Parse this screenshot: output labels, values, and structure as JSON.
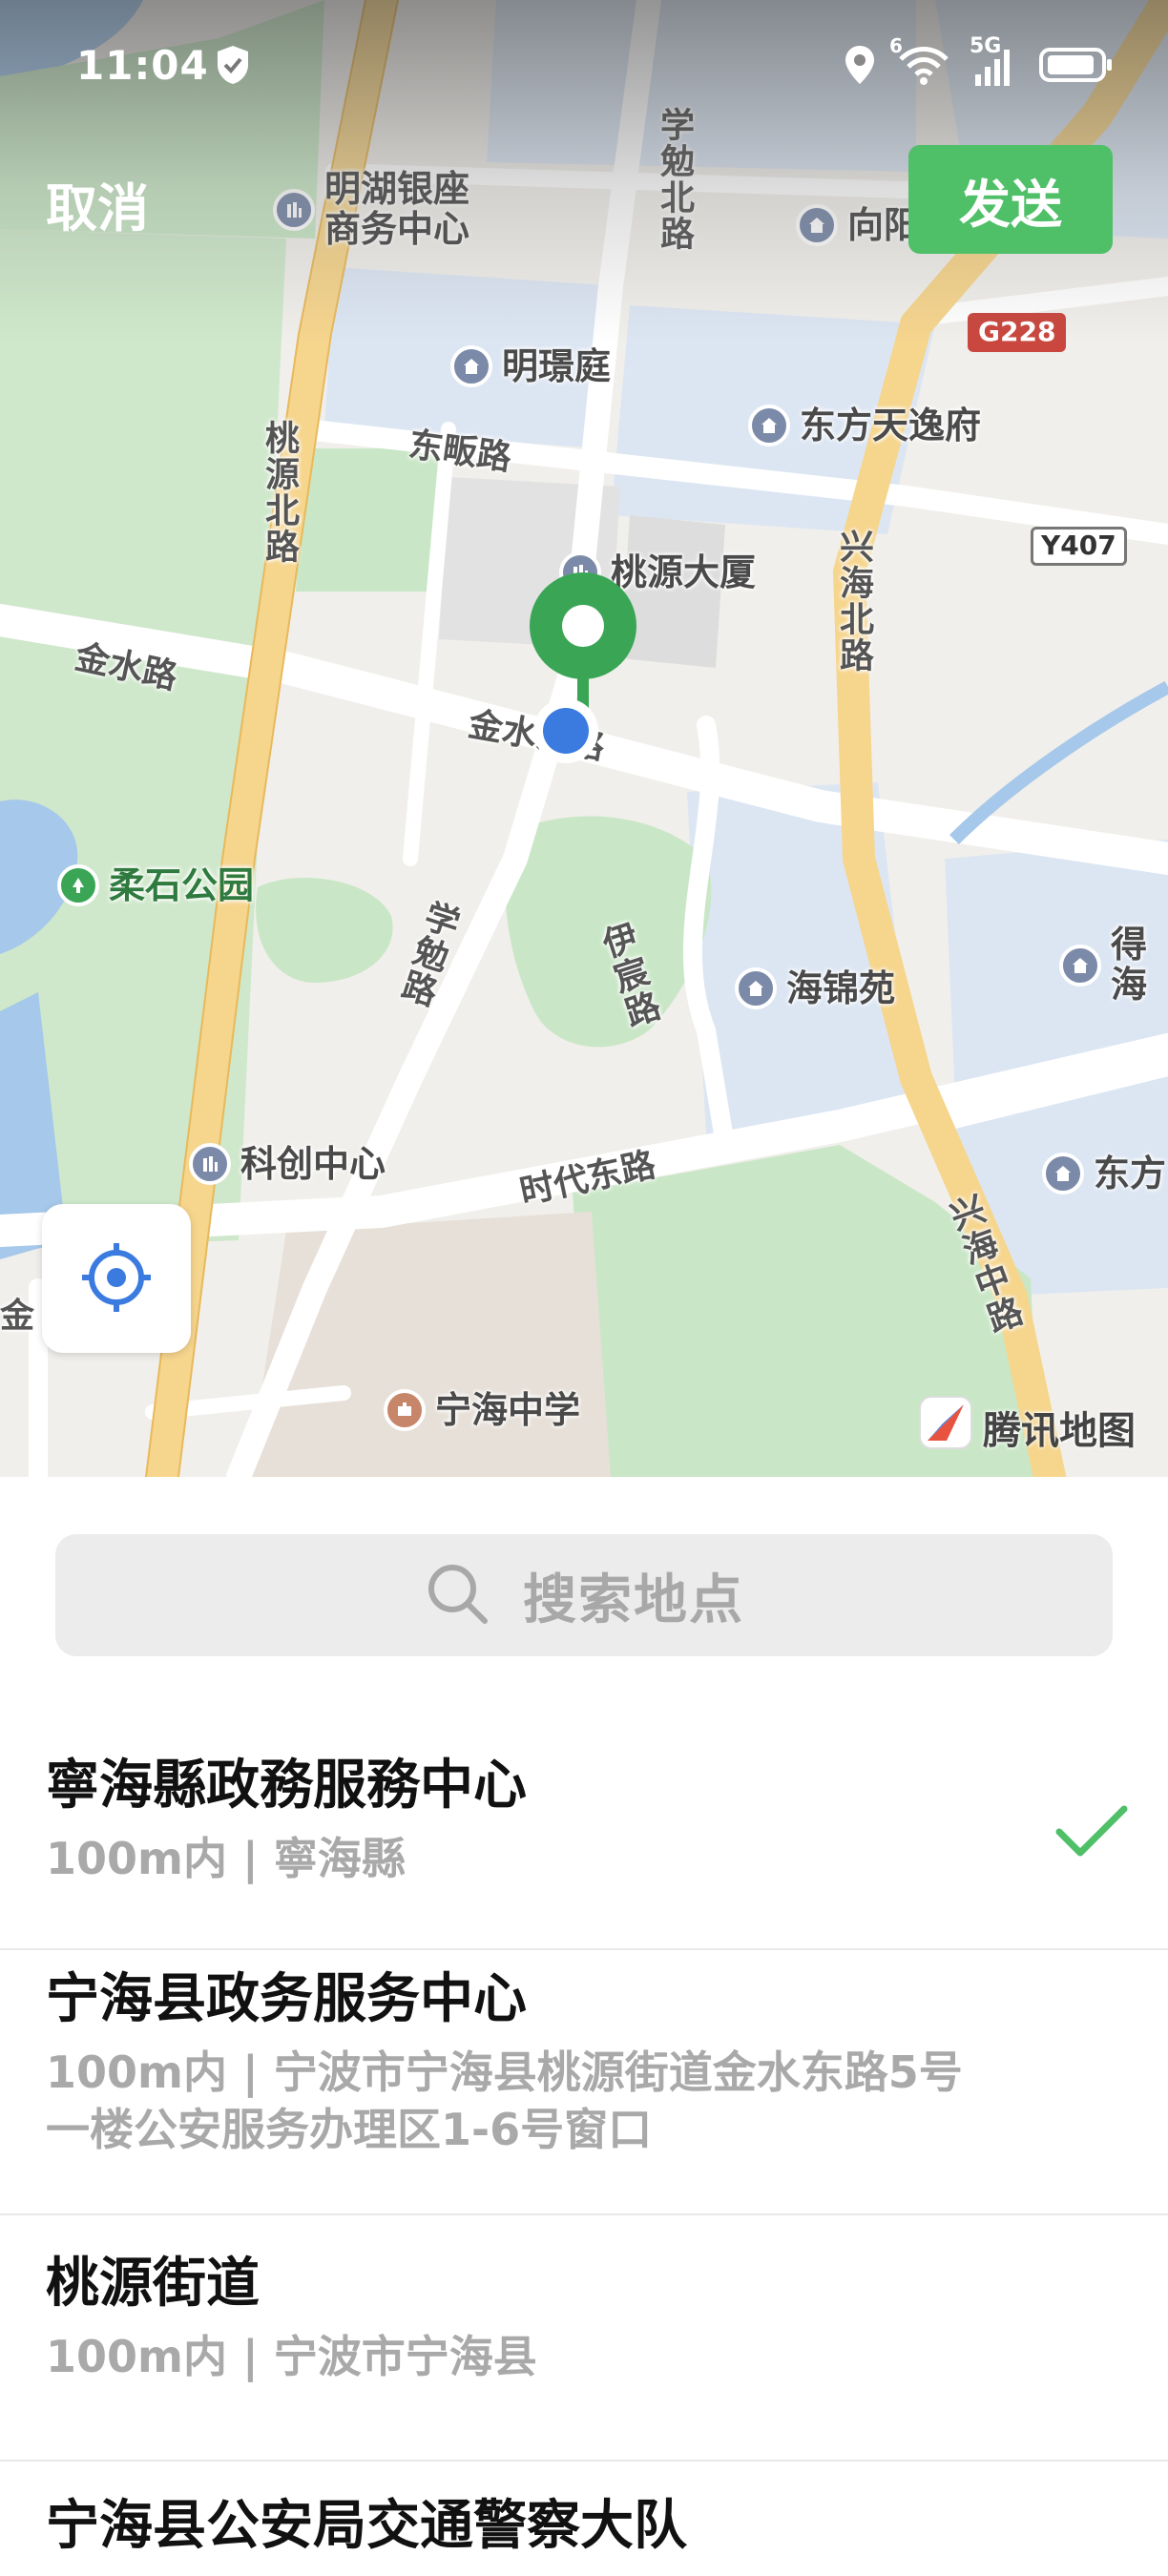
{
  "status_bar": {
    "time": "11:04",
    "icons": [
      "shield-check-icon",
      "location-icon",
      "wifi-icon",
      "5g-signal-icon",
      "battery-icon"
    ],
    "network_label": "5G",
    "wifi_label": "6"
  },
  "top_bar": {
    "cancel_label": "取消",
    "send_label": "发送"
  },
  "map": {
    "pois": {
      "minghu": "明湖银座\n商务中心",
      "mingjing": "明璟庭",
      "dongfang": "东方天逸府",
      "taoyuan_building": "桃源大厦",
      "roushi_park": "柔石公园",
      "haijin": "海锦苑",
      "kechuang": "科创中心",
      "ninghai_school": "宁海中学",
      "de_hai": "得\n海",
      "dong_fang2": "东方",
      "xiang": "向阳"
    },
    "roads": {
      "xuemian_north": "学勉北路",
      "taoyuan_north": "桃源北路",
      "dongfan": "东畈路",
      "jinshui": "金水路",
      "jinshui_east": "金水东路",
      "xuemian": "学勉路",
      "yichen": "伊宸路",
      "xinghai_north": "兴海北路",
      "shidai_east": "时代东路",
      "xinghai_middle": "兴海中路",
      "jin_left": "金"
    },
    "badges": {
      "g228": "G228",
      "y407": "Y407"
    },
    "brand": "腾讯地图",
    "locate_icon": "crosshair-icon",
    "pin_icon": "location-pin-icon"
  },
  "search": {
    "placeholder": "搜索地点",
    "icon": "search-icon"
  },
  "results": [
    {
      "title": "寧海縣政務服務中心",
      "subtitle": "100m内 | 寧海縣",
      "selected": true
    },
    {
      "title": "宁海县政务服务中心",
      "subtitle": "100m内 | 宁波市宁海县桃源街道金水东路5号一楼公安服务办理区1-6号窗口",
      "selected": false
    },
    {
      "title": "桃源街道",
      "subtitle": "100m内 | 宁波市宁海县",
      "selected": false
    },
    {
      "title": "宁海县公安局交通警察大队",
      "subtitle": "",
      "selected": false
    }
  ],
  "colors": {
    "accent_green": "#4fbf68",
    "road_yellow": "#f6d58d",
    "park_green": "#c9e7c6",
    "water_blue": "#a6c8ea",
    "district_blue": "#dce6f3"
  }
}
